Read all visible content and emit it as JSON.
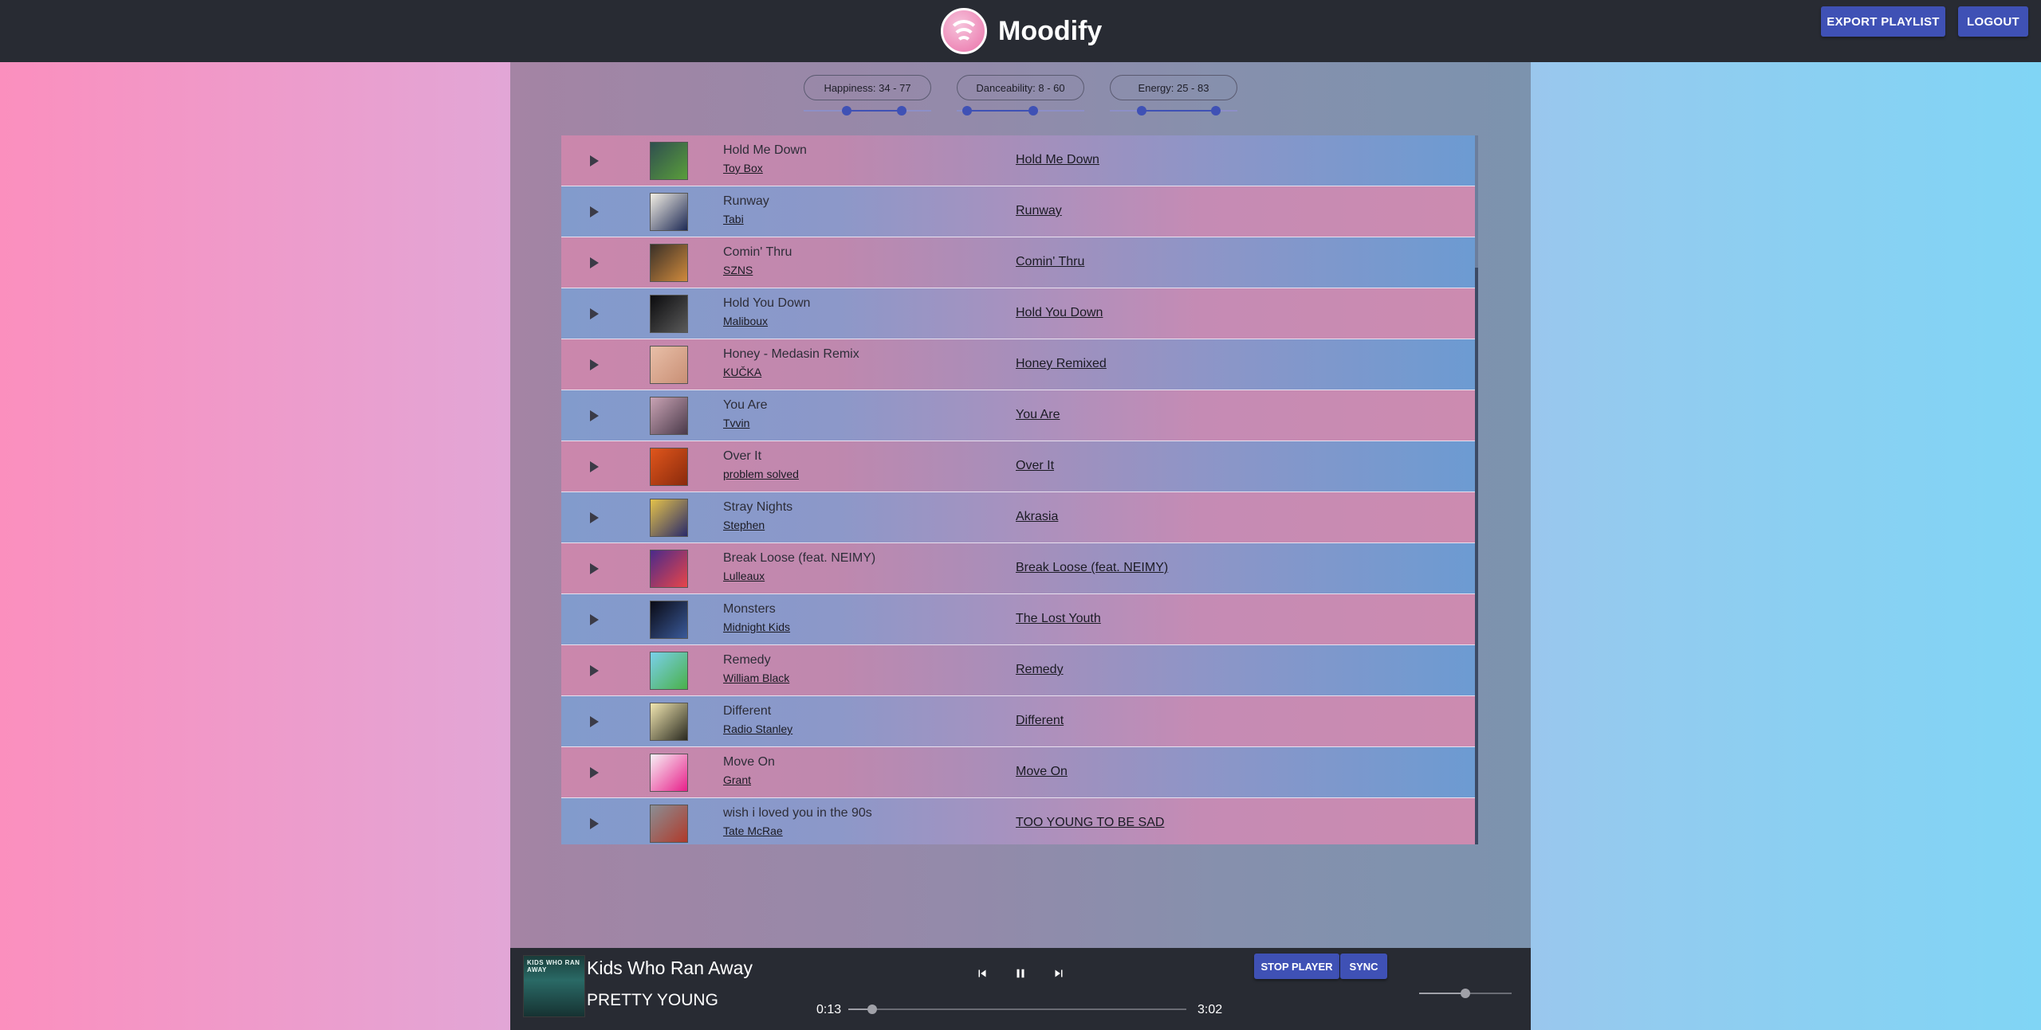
{
  "app": {
    "name": "Moodify",
    "logo_icon": "spotify-logo-icon"
  },
  "header": {
    "export_label": "EXPORT PLAYLIST",
    "logout_label": "LOGOUT"
  },
  "filters": [
    {
      "label": "Happiness: 34 - 77",
      "min": 34,
      "max": 77
    },
    {
      "label": "Danceability: 8 - 60",
      "min": 8,
      "max": 60
    },
    {
      "label": "Energy: 25 - 83",
      "min": 25,
      "max": 83
    }
  ],
  "tracks": [
    {
      "title": "Hold Me Down",
      "artist": "Toy Box",
      "match": "Hold Me Down",
      "art": [
        "#2f4f4f",
        "#5a9e3b"
      ]
    },
    {
      "title": "Runway",
      "artist": "Tabi",
      "match": "Runway",
      "art": [
        "#f3efe4",
        "#1e2a55"
      ]
    },
    {
      "title": "Comin' Thru",
      "artist": "SZNS",
      "match": "Comin' Thru",
      "art": [
        "#3a3028",
        "#d08a3c"
      ]
    },
    {
      "title": "Hold You Down",
      "artist": "Maliboux",
      "match": "Hold You Down",
      "art": [
        "#0b0b0d",
        "#5a5a5a"
      ]
    },
    {
      "title": "Honey - Medasin Remix",
      "artist": "KUČKA",
      "match": "Honey Remixed",
      "art": [
        "#e8bfa8",
        "#c98f75"
      ]
    },
    {
      "title": "You Are",
      "artist": "Tvvin",
      "match": "You Are",
      "art": [
        "#c9a3b4",
        "#4a3a4a"
      ]
    },
    {
      "title": "Over It",
      "artist": "problem solved",
      "match": "Over It",
      "art": [
        "#e0561c",
        "#8a2a0c"
      ]
    },
    {
      "title": "Stray Nights",
      "artist": "Stephen",
      "match": "Akrasia",
      "art": [
        "#e4c24a",
        "#2a2a6a"
      ]
    },
    {
      "title": "Break Loose (feat. NEIMY)",
      "artist": "Lulleaux",
      "match": "Break Loose (feat. NEIMY)",
      "art": [
        "#4a2a8a",
        "#e8454a"
      ]
    },
    {
      "title": "Monsters",
      "artist": "Midnight Kids",
      "match": "The Lost Youth",
      "art": [
        "#0a0a14",
        "#3a5a9a"
      ]
    },
    {
      "title": "Remedy",
      "artist": "William Black",
      "match": "Remedy",
      "art": [
        "#7ad0ea",
        "#4ab04a"
      ]
    },
    {
      "title": "Different",
      "artist": "Radio Stanley",
      "match": "Different",
      "art": [
        "#f1e6b0",
        "#2a2a20"
      ]
    },
    {
      "title": "Move On",
      "artist": "Grant",
      "match": "Move On",
      "art": [
        "#f7f0f5",
        "#e8208a"
      ]
    },
    {
      "title": "wish i loved you in the 90s",
      "artist": "Tate McRae",
      "match": "TOO YOUNG TO BE SAD",
      "art": [
        "#8a8e94",
        "#b03a2a"
      ]
    }
  ],
  "player": {
    "title": "Kids Who Ran Away",
    "artist": "PRETTY YOUNG",
    "art_caption": "KIDS WHO RAN AWAY",
    "elapsed": "0:13",
    "duration": "3:02",
    "progress_fraction": 0.071,
    "volume_fraction": 0.5,
    "stop_label": "STOP PLAYER",
    "sync_label": "SYNC",
    "controls": [
      "skip-previous-icon",
      "pause-icon",
      "skip-next-icon"
    ]
  },
  "colors": {
    "header_bg": "#282b33",
    "accent": "#3f51b5"
  }
}
